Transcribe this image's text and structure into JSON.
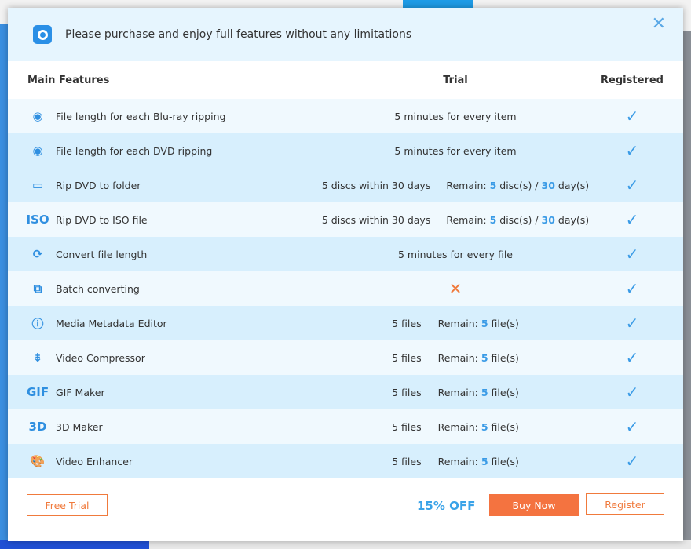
{
  "banner": {
    "text": "Please purchase and enjoy full features without any limitations",
    "close_icon": "close-icon"
  },
  "header": {
    "main": "Main Features",
    "trial": "Trial",
    "registered": "Registered"
  },
  "colors": {
    "accent": "#3a9be6",
    "orange": "#f47340",
    "row_light": "#f0f9fe",
    "row_dark": "#d7effd"
  },
  "rows": [
    {
      "icon": "bluray-disc-icon",
      "glyph": "◉",
      "label": "File length for each Blu-ray ripping",
      "trial": {
        "text": "5 minutes for every item"
      },
      "shade": "light"
    },
    {
      "icon": "dvd-disc-icon",
      "glyph": "◉",
      "label": "File length for each DVD ripping",
      "trial": {
        "text": "5 minutes for every item"
      },
      "shade": "dark"
    },
    {
      "icon": "dvd-folder-icon",
      "glyph": "▭",
      "label": "Rip DVD to folder",
      "trial": {
        "limit": "5 discs within 30 days",
        "remain_label": "Remain:",
        "n1": "5",
        "u1": "disc(s) /",
        "n2": "30",
        "u2": "day(s)"
      },
      "shade": "dark"
    },
    {
      "icon": "dvd-iso-icon",
      "glyph": "ISO",
      "label": "Rip DVD to ISO file",
      "trial": {
        "limit": "5 discs within 30 days",
        "remain_label": "Remain:",
        "n1": "5",
        "u1": "disc(s) /",
        "n2": "30",
        "u2": "day(s)"
      },
      "shade": "light"
    },
    {
      "icon": "convert-cycle-icon",
      "glyph": "⟳",
      "label": "Convert file length",
      "trial": {
        "text": "5 minutes for every file"
      },
      "shade": "dark"
    },
    {
      "icon": "batch-icon",
      "glyph": "⧉",
      "label": "Batch converting",
      "trial": {
        "unavailable": "✕"
      },
      "shade": "light"
    },
    {
      "icon": "info-icon",
      "glyph": "ⓘ",
      "label": "Media Metadata Editor",
      "trial": {
        "limit": "5 files",
        "remain_label": "Remain:",
        "n1": "5",
        "u1": "file(s)"
      },
      "shade": "dark"
    },
    {
      "icon": "compress-icon",
      "glyph": "⇟",
      "label": "Video Compressor",
      "trial": {
        "limit": "5 files",
        "remain_label": "Remain:",
        "n1": "5",
        "u1": "file(s)"
      },
      "shade": "light"
    },
    {
      "icon": "gif-icon",
      "glyph": "GIF",
      "label": "GIF Maker",
      "trial": {
        "limit": "5 files",
        "remain_label": "Remain:",
        "n1": "5",
        "u1": "file(s)"
      },
      "shade": "dark"
    },
    {
      "icon": "3d-icon",
      "glyph": "3D",
      "label": "3D Maker",
      "trial": {
        "limit": "5 files",
        "remain_label": "Remain:",
        "n1": "5",
        "u1": "file(s)"
      },
      "shade": "light"
    },
    {
      "icon": "palette-icon",
      "glyph": "🎨",
      "label": "Video Enhancer",
      "trial": {
        "limit": "5 files",
        "remain_label": "Remain:",
        "n1": "5",
        "u1": "file(s)"
      },
      "shade": "dark"
    }
  ],
  "footer": {
    "free_trial": "Free Trial",
    "discount": "15% OFF",
    "buy_now": "Buy Now",
    "register": "Register"
  }
}
